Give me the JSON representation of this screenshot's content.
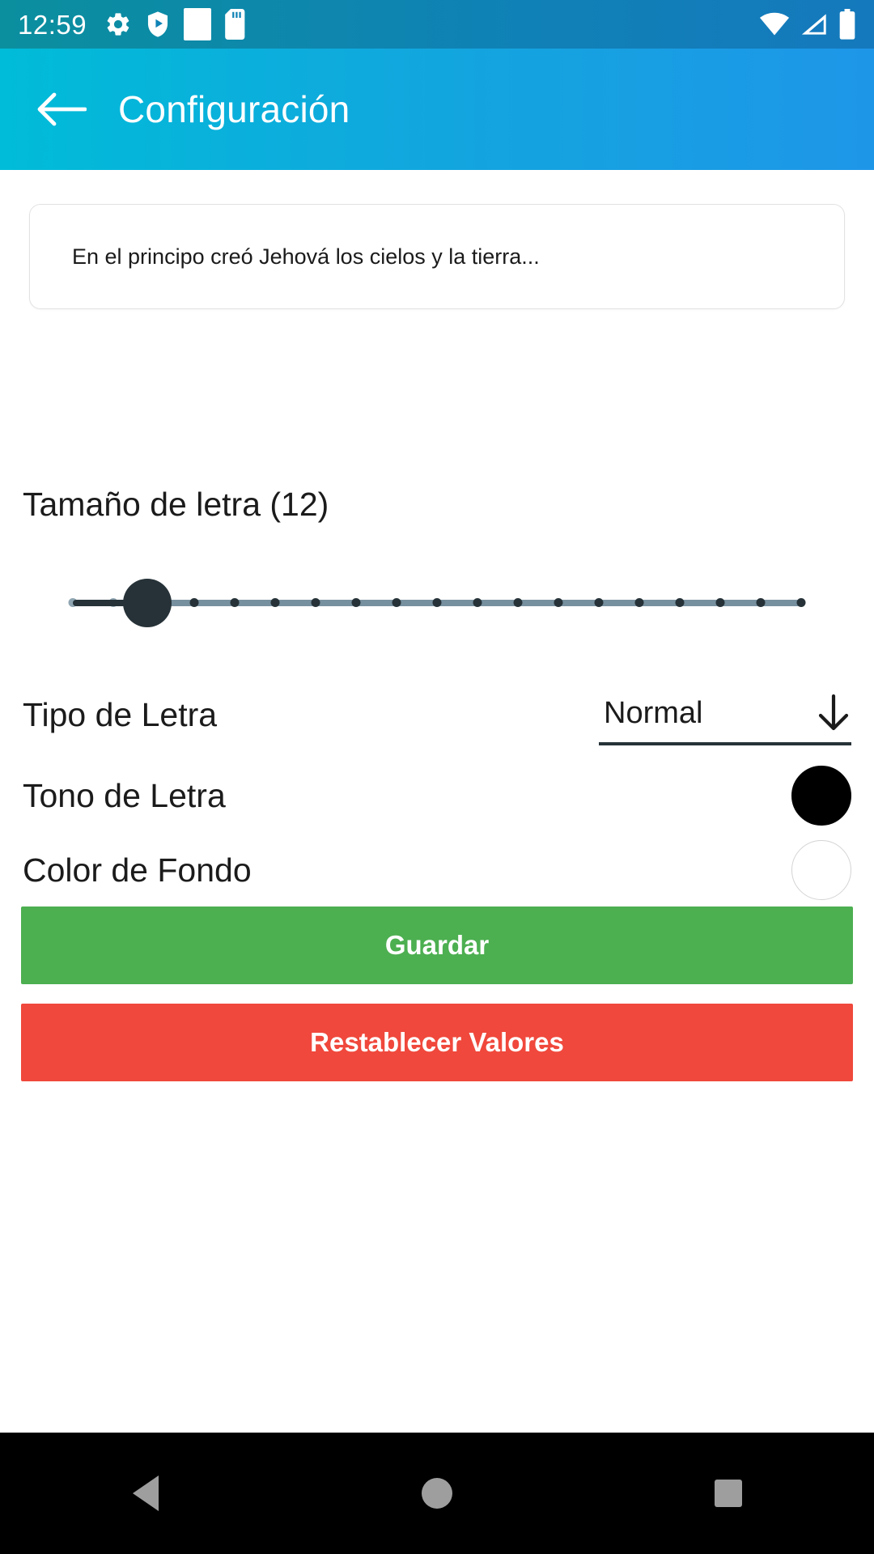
{
  "status_bar": {
    "time": "12:59",
    "left_icons": [
      "gear-icon",
      "shield-play-icon",
      "white-square-icon",
      "sd-card-icon"
    ],
    "right_icons": [
      "wifi-icon",
      "signal-icon",
      "battery-icon"
    ],
    "background_start": "#0b8f9e",
    "background_end": "#1579bd"
  },
  "app_bar": {
    "back_icon": "back-arrow-icon",
    "title": "Configuración",
    "background_start": "#00bcd8",
    "background_end": "#1e96e8"
  },
  "preview": {
    "text": "En el principo creó Jehová los cielos y la tierra..."
  },
  "font_size": {
    "label": "Tamaño de letra (12)",
    "value": 12,
    "min": 1,
    "max": 20,
    "tick_count": 19,
    "thumb_color": "#263238",
    "active_track_color": "#263238",
    "inactive_track_color": "#77909f"
  },
  "rows": {
    "font_type": {
      "label": "Tipo de Letra",
      "value": "Normal",
      "arrow_icon": "arrow-down-icon"
    },
    "font_tone": {
      "label": "Tono de Letra",
      "color": "#000000"
    },
    "background_color": {
      "label": "Color de Fondo",
      "color": "#ffffff"
    }
  },
  "buttons": {
    "save": {
      "label": "Guardar",
      "color": "#4caf50"
    },
    "reset": {
      "label": "Restablecer Valores",
      "color": "#f0483c"
    }
  },
  "nav_bar": {
    "back": "nav-back-icon",
    "home": "nav-home-icon",
    "recents": "nav-recents-icon"
  }
}
